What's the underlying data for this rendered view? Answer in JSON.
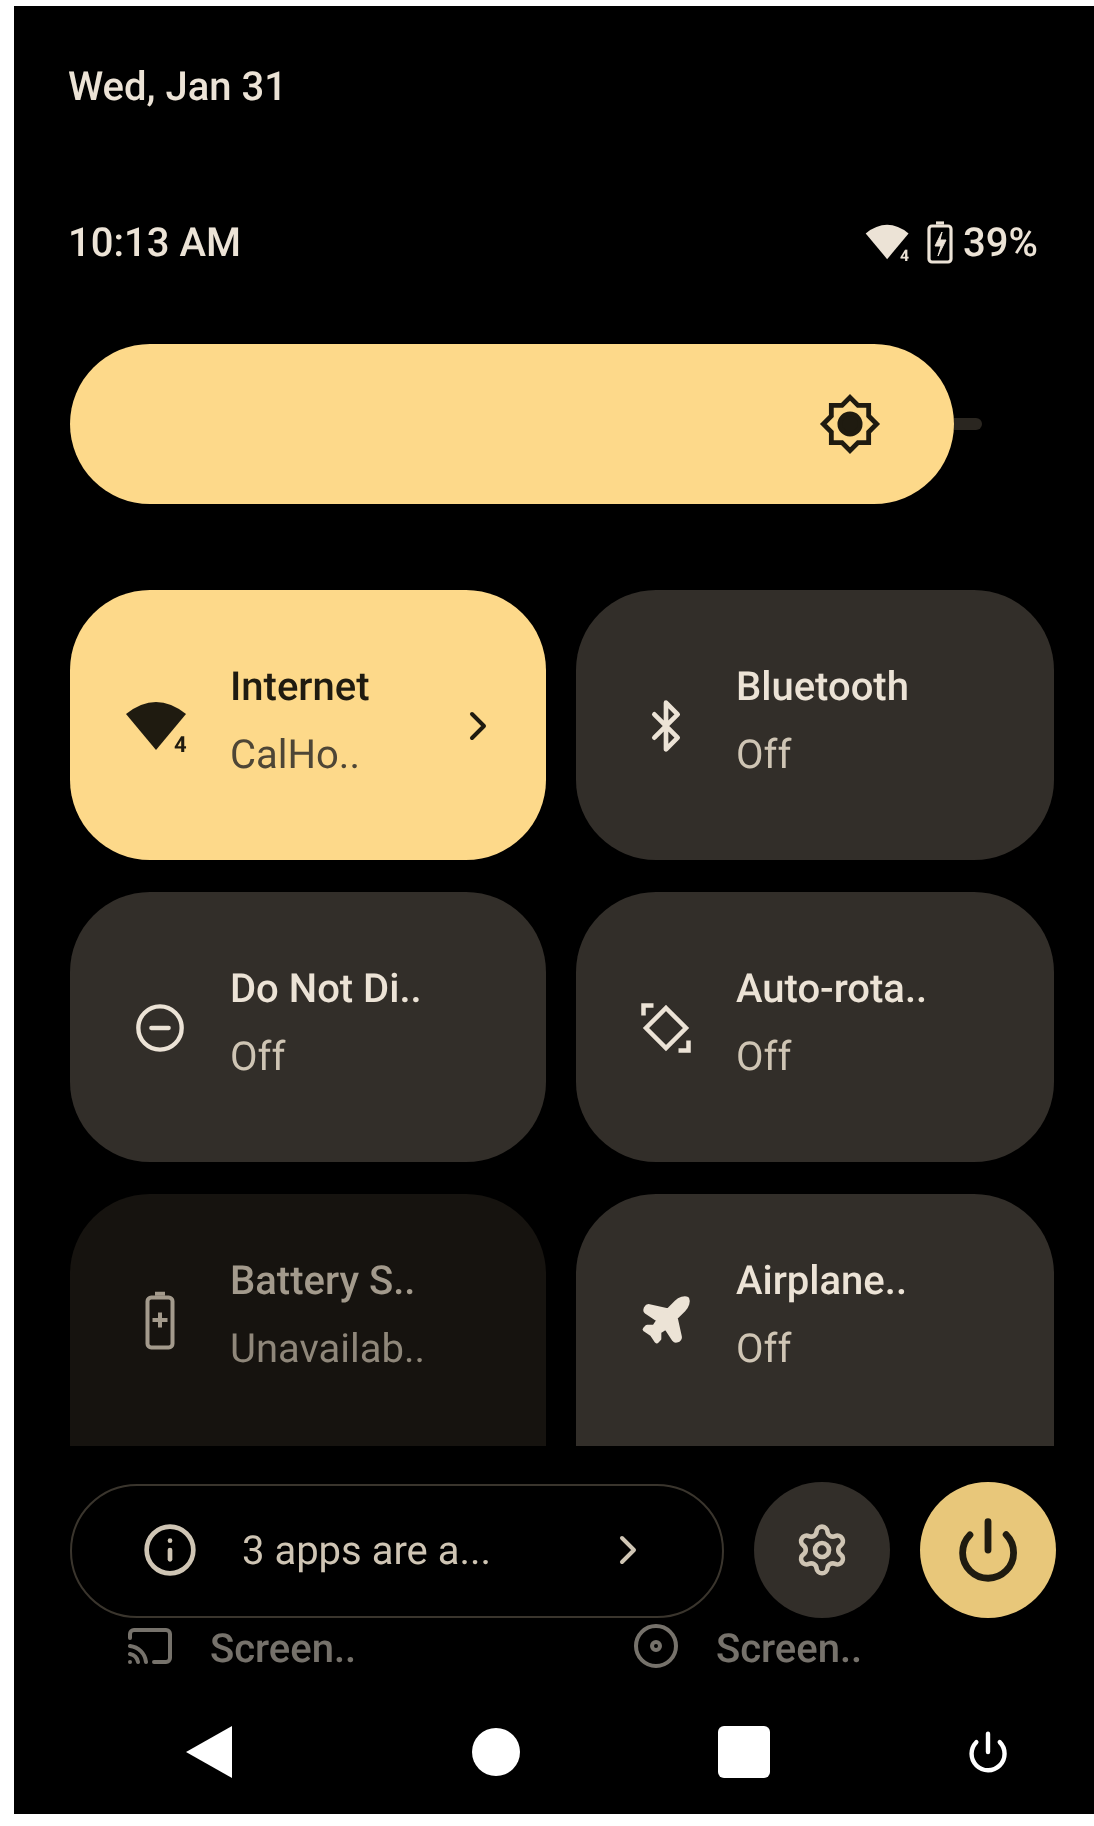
{
  "header": {
    "date": "Wed, Jan 31",
    "time": "10:13 AM",
    "network_badge": "4",
    "battery": "39%"
  },
  "brightness": {
    "level": 0.97
  },
  "tiles": [
    {
      "title": "Internet",
      "subtitle": "CalHo..",
      "badge": "4",
      "on": true,
      "disabled": false,
      "has_chevron": true
    },
    {
      "title": "Bluetooth",
      "subtitle": "Off",
      "on": false,
      "disabled": false,
      "has_chevron": false
    },
    {
      "title": "Do Not Di..",
      "subtitle": "Off",
      "on": false,
      "disabled": false,
      "has_chevron": false
    },
    {
      "title": "Auto-rota..",
      "subtitle": "Off",
      "on": false,
      "disabled": false,
      "has_chevron": false
    },
    {
      "title": "Battery S..",
      "subtitle": "Unavailab..",
      "on": false,
      "disabled": true,
      "has_chevron": false
    },
    {
      "title": "Airplane..",
      "subtitle": "Off",
      "on": false,
      "disabled": false,
      "has_chevron": false
    }
  ],
  "hidden_tiles": [
    {
      "title": "Screen.."
    },
    {
      "title": "Screen.."
    }
  ],
  "footer": {
    "message": "3 apps are a..."
  }
}
